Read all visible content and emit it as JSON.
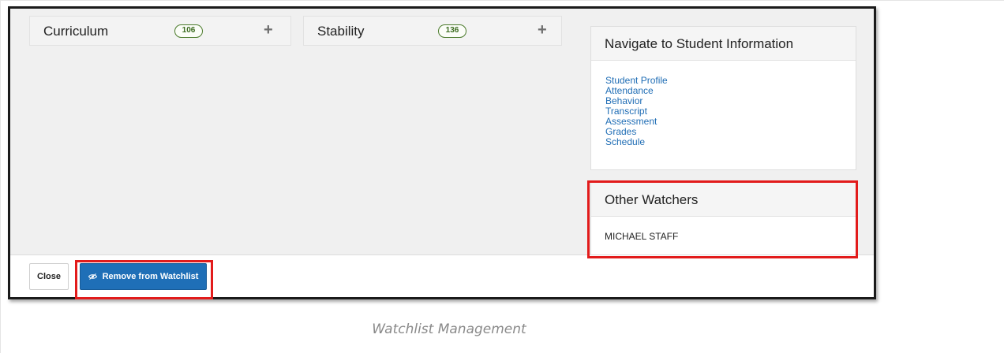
{
  "categories": [
    {
      "title": "Curriculum",
      "count": "106"
    },
    {
      "title": "Stability",
      "count": "136"
    }
  ],
  "nav_panel": {
    "title": "Navigate to Student Information",
    "links": [
      "Student Profile",
      "Attendance",
      "Behavior",
      "Transcript",
      "Assessment",
      "Grades",
      "Schedule"
    ]
  },
  "watchers_panel": {
    "title": "Other Watchers",
    "names": [
      "MICHAEL STAFF"
    ]
  },
  "footer": {
    "close_label": "Close",
    "remove_label": "Remove from Watchlist"
  },
  "caption": "Watchlist Management",
  "colors": {
    "primary_button": "#1f6fb7",
    "link": "#1f6db5",
    "badge_green": "#4a7a2a",
    "highlight_red": "#e21b1b"
  },
  "icons": {
    "expand": "plus-icon",
    "watch": "eye-slash-icon"
  }
}
